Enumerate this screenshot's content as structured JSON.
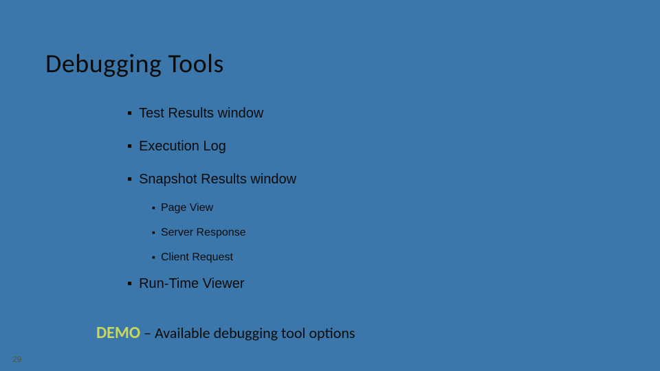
{
  "title": "Debugging Tools",
  "bullets": {
    "b0": "Test Results window",
    "b1": "Execution Log",
    "b2": "Snapshot Results window",
    "b2_sub": {
      "s0": "Page View",
      "s1": "Server Response",
      "s2": "Client Request"
    },
    "b3": "Run-Time Viewer"
  },
  "demo": {
    "label": "DEMO",
    "text": " – Available debugging tool options"
  },
  "page_number": "29",
  "marker": "▪"
}
